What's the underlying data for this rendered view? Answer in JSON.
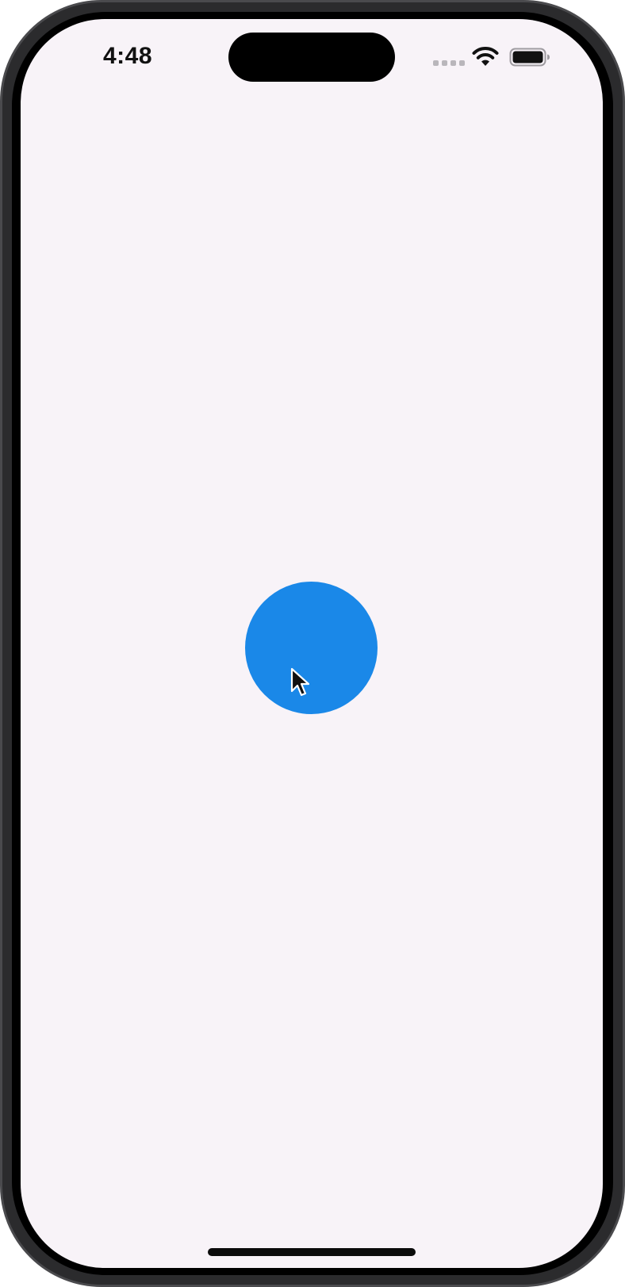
{
  "status_bar": {
    "time": "4:48",
    "icons": [
      "signal-dots-icon",
      "wifi-icon",
      "battery-icon"
    ]
  },
  "main": {
    "circle_color": "#1a88e8",
    "background_color": "#f8f3f8"
  },
  "pointer": {
    "icon": "cursor-arrow-icon"
  }
}
